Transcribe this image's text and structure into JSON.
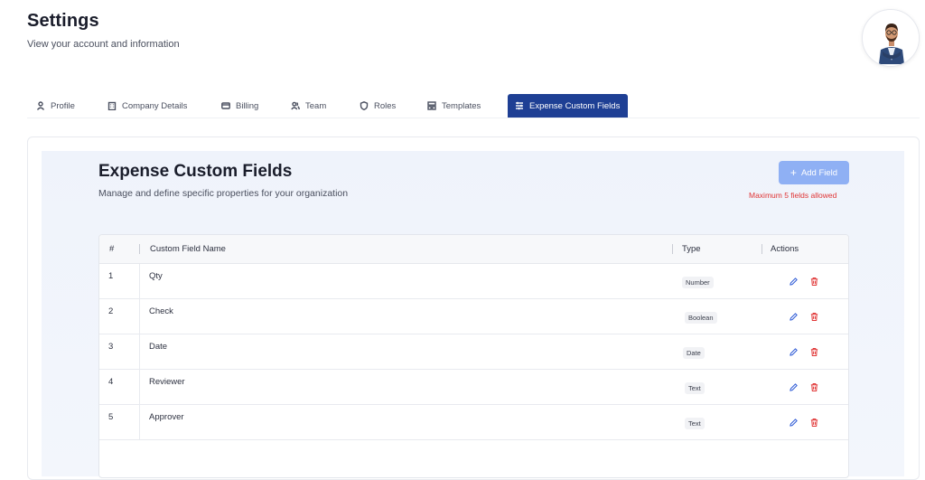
{
  "header": {
    "title": "Settings",
    "subtitle": "View your account and information"
  },
  "tabs": [
    {
      "label": "Profile",
      "icon": "user-icon",
      "active": false
    },
    {
      "label": "Company Details",
      "icon": "building-icon",
      "active": false
    },
    {
      "label": "Billing",
      "icon": "credit-card-icon",
      "active": false
    },
    {
      "label": "Team",
      "icon": "users-icon",
      "active": false
    },
    {
      "label": "Roles",
      "icon": "shield-icon",
      "active": false
    },
    {
      "label": "Templates",
      "icon": "template-icon",
      "active": false
    },
    {
      "label": "Expense Custom Fields",
      "icon": "sliders-icon",
      "active": true
    }
  ],
  "section": {
    "title": "Expense Custom Fields",
    "subtitle": "Manage and define specific properties for your organization",
    "add_button_label": "Add Field",
    "limit_note": "Maximum 5 fields allowed"
  },
  "table": {
    "columns": [
      "#",
      "Custom Field Name",
      "Type",
      "Actions"
    ],
    "rows": [
      {
        "index": "1",
        "name": "Qty",
        "type": "Number"
      },
      {
        "index": "2",
        "name": "Check",
        "type": "Boolean"
      },
      {
        "index": "3",
        "name": "Date",
        "type": "Date"
      },
      {
        "index": "4",
        "name": "Reviewer",
        "type": "Text"
      },
      {
        "index": "5",
        "name": "Approver",
        "type": "Text"
      }
    ]
  },
  "colors": {
    "accent": "#1e3f94",
    "add_button": "#8fb0f4",
    "danger": "#e03535",
    "edit": "#2f5bd6"
  }
}
